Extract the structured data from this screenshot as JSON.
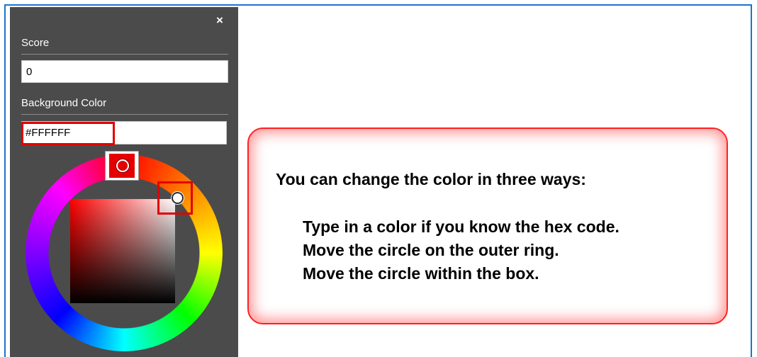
{
  "panel": {
    "close_glyph": "×",
    "score": {
      "label": "Score",
      "value": "0"
    },
    "background_color": {
      "label": "Background Color",
      "value": "#FFFFFF"
    }
  },
  "color_picker": {
    "wheel_icon": "hue-ring",
    "selected_hue": "#e40000"
  },
  "colors": {
    "frame_border": "#1b75c9",
    "panel_bg": "#4b4b4b",
    "callout_red": "#e00000"
  },
  "callout": {
    "title": "You can change the color in three ways:",
    "lines": [
      "Type in a color if you know the hex code.",
      "Move the circle on the outer ring.",
      "Move the circle within the box."
    ]
  }
}
